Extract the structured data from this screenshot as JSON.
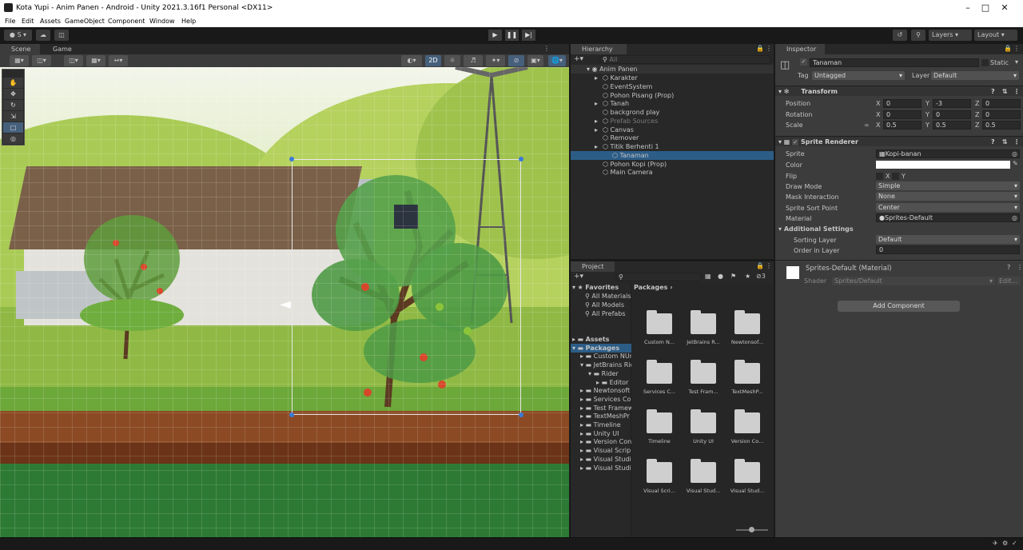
{
  "window": {
    "title": "Kota Yupi - Anim Panen - Android - Unity 2021.3.16f1 Personal <DX11>"
  },
  "menu": [
    "File",
    "Edit",
    "Assets",
    "GameObject",
    "Component",
    "Window",
    "Help"
  ],
  "toolbar": {
    "account": "S",
    "layers": "Layers",
    "layout": "Layout"
  },
  "scene_tabs": [
    "Scene",
    "Game"
  ],
  "scene_toolbar": {
    "mode_2d": "2D"
  },
  "hierarchy": {
    "title": "Hierarchy",
    "search_placeholder": "All",
    "root": "Anim Panen",
    "items": [
      {
        "label": "Karakter",
        "depth": 1,
        "arrow": true
      },
      {
        "label": "EventSystem",
        "depth": 1,
        "arrow": false
      },
      {
        "label": "Pohon Pisang (Prop)",
        "depth": 1,
        "arrow": false
      },
      {
        "label": "Tanah",
        "depth": 1,
        "arrow": true
      },
      {
        "label": "backgrond play",
        "depth": 1,
        "arrow": false
      },
      {
        "label": "Prefab Sources",
        "depth": 1,
        "arrow": true
      },
      {
        "label": "Canvas",
        "depth": 1,
        "arrow": true
      },
      {
        "label": "Remover",
        "depth": 1,
        "arrow": false
      },
      {
        "label": "Titik Berhenti 1",
        "depth": 1,
        "arrow": true
      },
      {
        "label": "Tanaman",
        "depth": 2,
        "arrow": false
      },
      {
        "label": "Pohon Kopi (Prop)",
        "depth": 1,
        "arrow": false
      },
      {
        "label": "Main Camera",
        "depth": 1,
        "arrow": false
      }
    ]
  },
  "project": {
    "title": "Project",
    "favorites_title": "Favorites",
    "favorites": [
      "All Materials",
      "All Models",
      "All Prefabs"
    ],
    "tree": [
      {
        "label": "Assets",
        "depth": 0
      },
      {
        "label": "Packages",
        "depth": 0
      },
      {
        "label": "Custom NUnit",
        "depth": 1
      },
      {
        "label": "JetBrains Rider",
        "depth": 1
      },
      {
        "label": "Rider",
        "depth": 2
      },
      {
        "label": "Editor",
        "depth": 3
      },
      {
        "label": "Newtonsoft",
        "depth": 1
      },
      {
        "label": "Services Co",
        "depth": 1
      },
      {
        "label": "Test Framew",
        "depth": 1
      },
      {
        "label": "TextMeshPr",
        "depth": 1
      },
      {
        "label": "Timeline",
        "depth": 1
      },
      {
        "label": "Unity UI",
        "depth": 1
      },
      {
        "label": "Version Con",
        "depth": 1
      },
      {
        "label": "Visual Scrip",
        "depth": 1
      },
      {
        "label": "Visual Studi",
        "depth": 1
      },
      {
        "label": "Visual Studi",
        "depth": 1
      }
    ],
    "breadcrumb": "Packages",
    "hidden_count": "3",
    "folders": [
      "Custom N...",
      "JetBrains R...",
      "Newtonsof...",
      "Services C...",
      "Test Fram...",
      "TextMeshP...",
      "Timeline",
      "Unity UI",
      "Version Co...",
      "Visual Scri...",
      "Visual Stud...",
      "Visual Stud..."
    ]
  },
  "inspector": {
    "title": "Inspector",
    "object_name": "Tanaman",
    "static_label": "Static",
    "tag_label": "Tag",
    "tag": "Untagged",
    "layer_label": "Layer",
    "layer": "Default",
    "transform": {
      "title": "Transform",
      "position": {
        "label": "Position",
        "x": "0",
        "y": "-3",
        "z": "0"
      },
      "rotation": {
        "label": "Rotation",
        "x": "0",
        "y": "0",
        "z": "0"
      },
      "scale": {
        "label": "Scale",
        "x": "0.5",
        "y": "0.5",
        "z": "0.5"
      }
    },
    "sprite_renderer": {
      "title": "Sprite Renderer",
      "sprite_label": "Sprite",
      "sprite": "Kopi-banan",
      "color_label": "Color",
      "flip_label": "Flip",
      "flip_x": "X",
      "flip_y": "Y",
      "draw_mode_label": "Draw Mode",
      "draw_mode": "Simple",
      "mask_label": "Mask Interaction",
      "mask": "None",
      "sort_point_label": "Sprite Sort Point",
      "sort_point": "Center",
      "material_label": "Material",
      "material": "Sprites-Default",
      "additional": "Additional Settings",
      "sorting_layer_label": "Sorting Layer",
      "sorting_layer": "Default",
      "order_label": "Order in Layer",
      "order": "0"
    },
    "material": {
      "name": "Sprites-Default (Material)",
      "shader_label": "Shader",
      "shader": "Sprites/Default",
      "edit": "Edit..."
    },
    "add_component": "Add Component"
  },
  "colors": {
    "selection": "#2c5d87",
    "panel": "#282828",
    "header": "#3c3c3c"
  }
}
